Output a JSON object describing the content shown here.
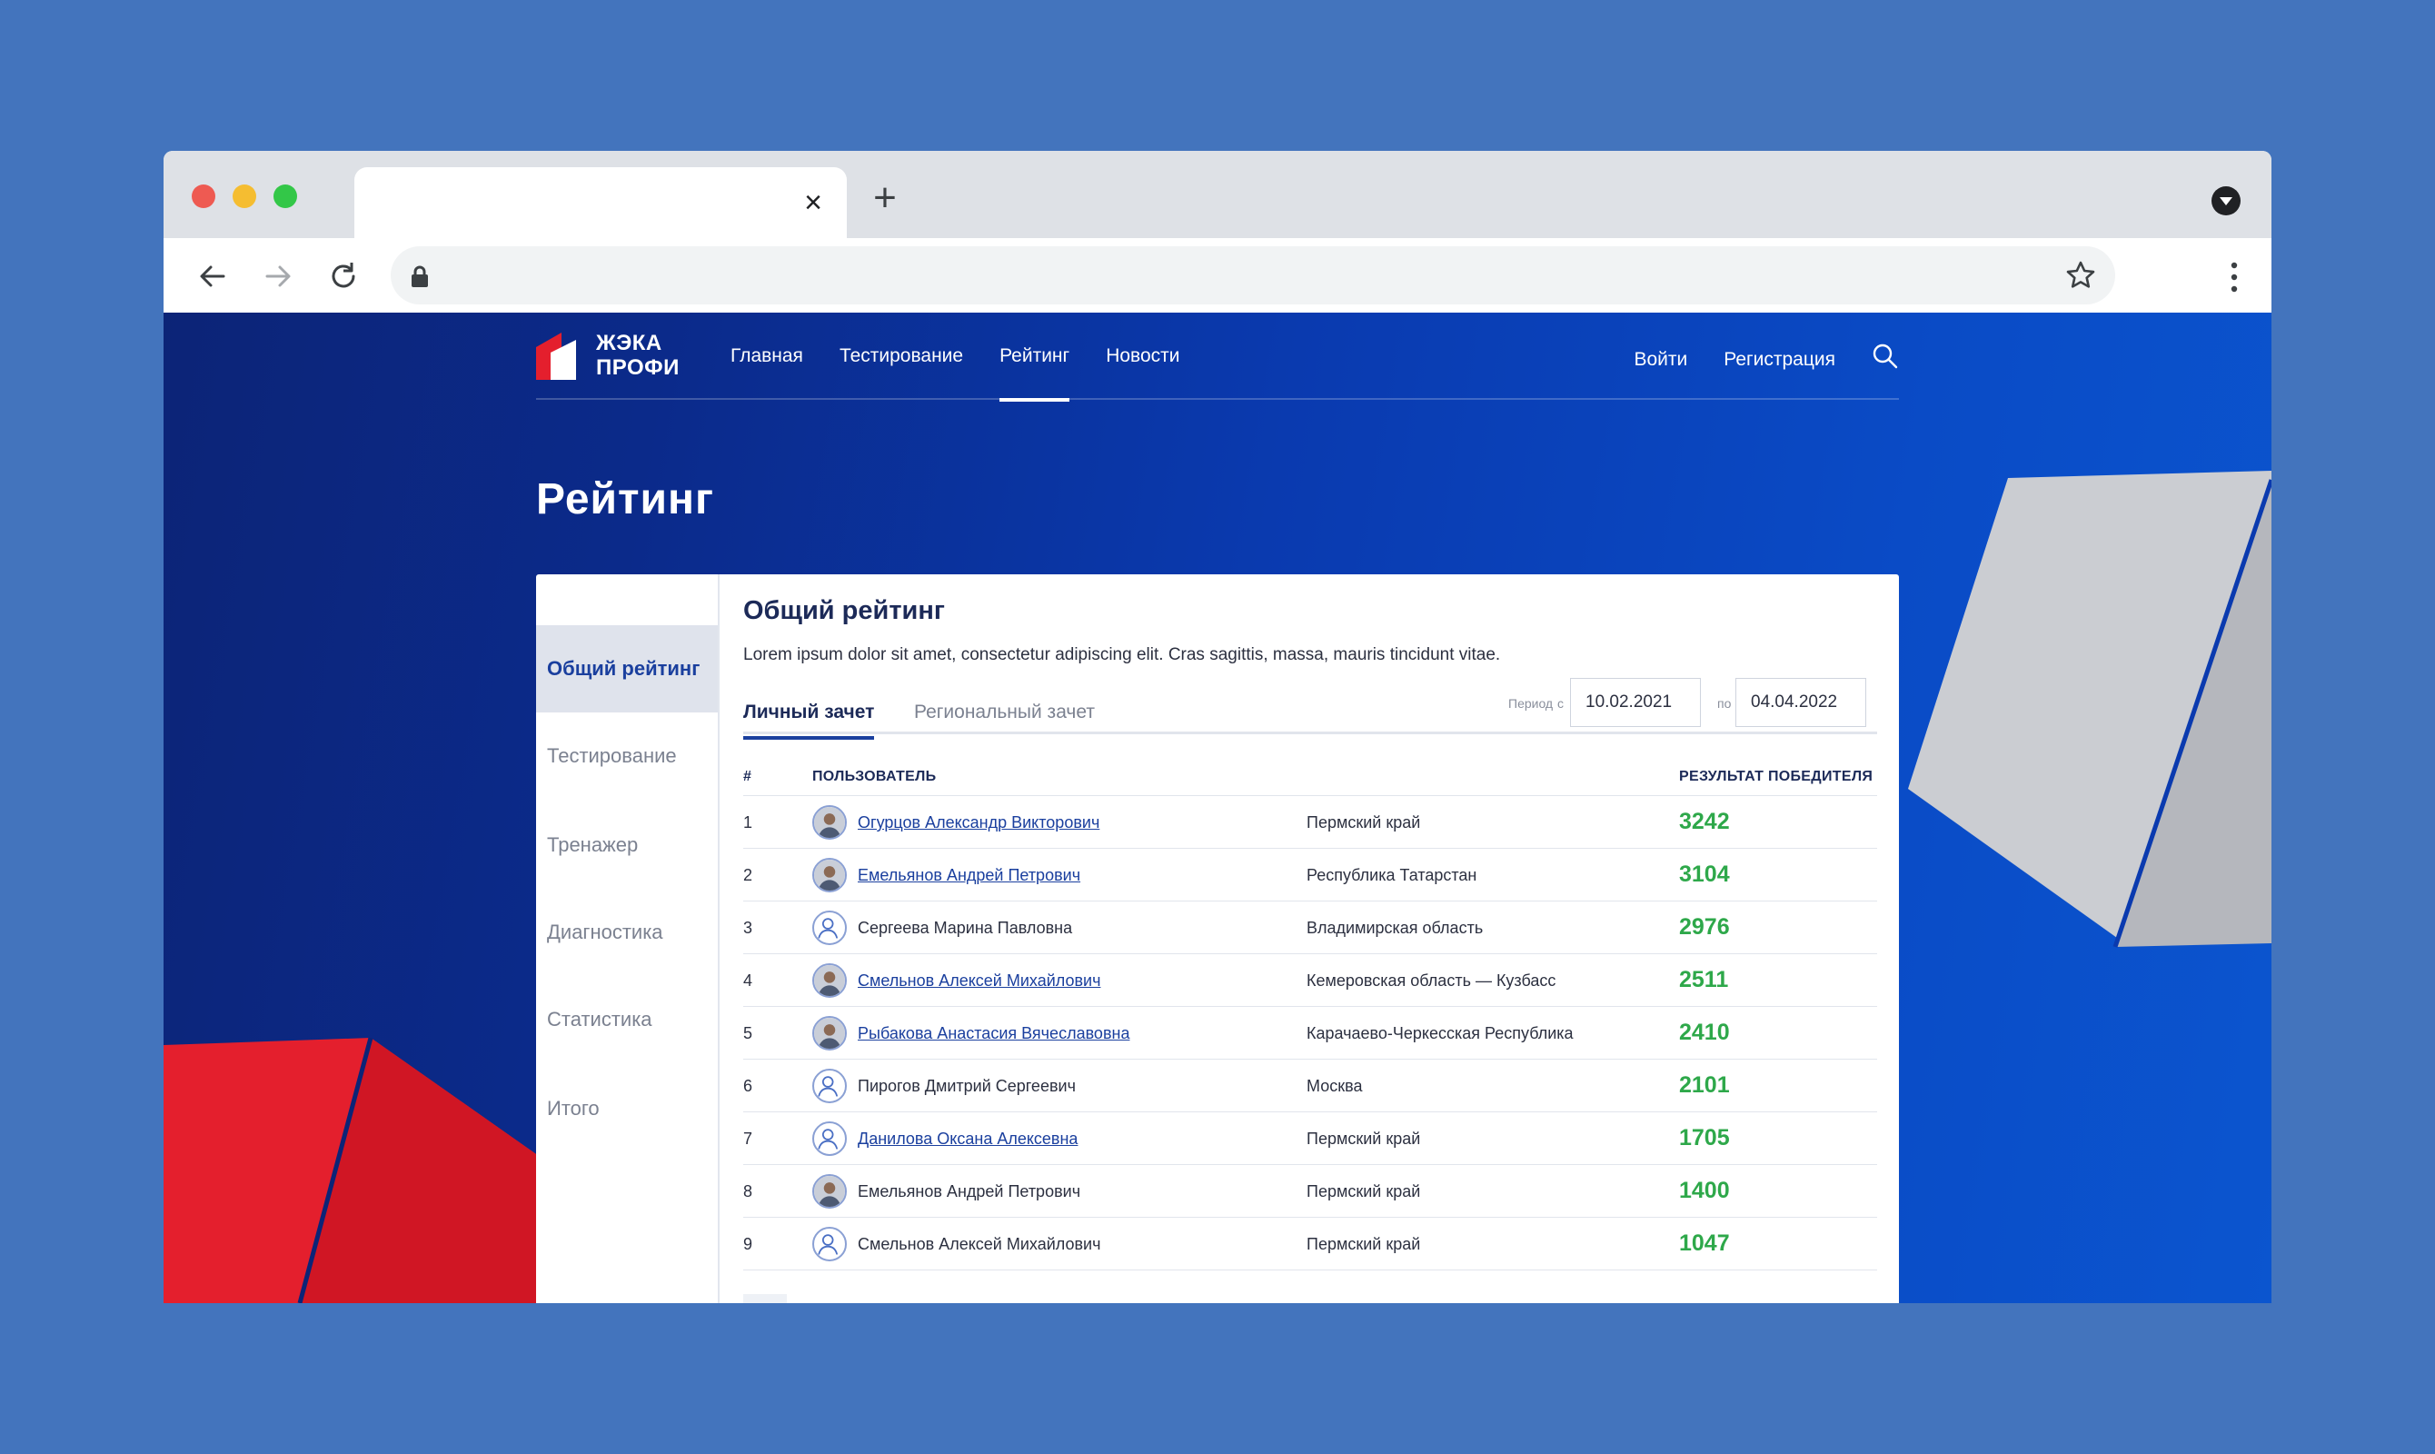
{
  "browser": {
    "tab_close": "×",
    "new_tab": "+"
  },
  "site": {
    "logo_line1": "ЖЭКА",
    "logo_line2": "ПРОФИ",
    "nav": [
      "Главная",
      "Тестирование",
      "Рейтинг",
      "Новости"
    ],
    "active_nav": "Рейтинг",
    "login": "Войти",
    "register": "Регистрация"
  },
  "page": {
    "title": "Рейтинг"
  },
  "sidebar": {
    "items": [
      "Общий рейтинг",
      "Тестирование",
      "Тренажер",
      "Диагностика",
      "Статистика",
      "Итого"
    ],
    "active": "Общий рейтинг"
  },
  "content": {
    "title": "Общий рейтинг",
    "description": "Lorem ipsum dolor sit amet, consectetur adipiscing elit. Cras sagittis, massa, mauris tincidunt vitae.",
    "tabs": [
      "Личный зачет",
      "Региональный зачет"
    ],
    "period_label": "Период",
    "from_label": "с",
    "to_label": "по",
    "date_from": "10.02.2021",
    "date_to": "04.04.2022"
  },
  "table": {
    "headers": {
      "num": "#",
      "user": "ПОЛЬЗОВАТЕЛЬ",
      "result": "РЕЗУЛЬТАТ ПОБЕДИТЕЛЯ"
    },
    "rows": [
      {
        "num": "1",
        "name": "Огурцов Александр Викторович",
        "region": "Пермский край",
        "score": "3242",
        "link": true,
        "avatar": "photo"
      },
      {
        "num": "2",
        "name": "Емельянов Андрей Петрович",
        "region": "Республика Татарстан",
        "score": "3104",
        "link": true,
        "avatar": "photo"
      },
      {
        "num": "3",
        "name": "Сергеева Марина Павловна",
        "region": "Владимирская область",
        "score": "2976",
        "link": false,
        "avatar": "placeholder"
      },
      {
        "num": "4",
        "name": "Смельнов Алексей Михайлович",
        "region": "Кемеровская область — Кузбасс",
        "score": "2511",
        "link": true,
        "avatar": "photo"
      },
      {
        "num": "5",
        "name": "Рыбакова Анастасия Вячеславовна",
        "region": "Карачаево-Черкесская Республика",
        "score": "2410",
        "link": true,
        "avatar": "photo"
      },
      {
        "num": "6",
        "name": "Пирогов Дмитрий Сергеевич",
        "region": "Москва",
        "score": "2101",
        "link": false,
        "avatar": "placeholder"
      },
      {
        "num": "7",
        "name": "Данилова Оксана Алексевна",
        "region": "Пермский край",
        "score": "1705",
        "link": true,
        "avatar": "placeholder"
      },
      {
        "num": "8",
        "name": "Емельянов Андрей Петрович",
        "region": "Пермский край",
        "score": "1400",
        "link": false,
        "avatar": "photo"
      },
      {
        "num": "9",
        "name": "Смельнов Алексей Михайлович",
        "region": "Пермский край",
        "score": "1047",
        "link": false,
        "avatar": "placeholder"
      }
    ]
  },
  "colors": {
    "brand_blue": "#1a3f9e",
    "score_green": "#2ea84a",
    "brand_red": "#e41f2d"
  }
}
